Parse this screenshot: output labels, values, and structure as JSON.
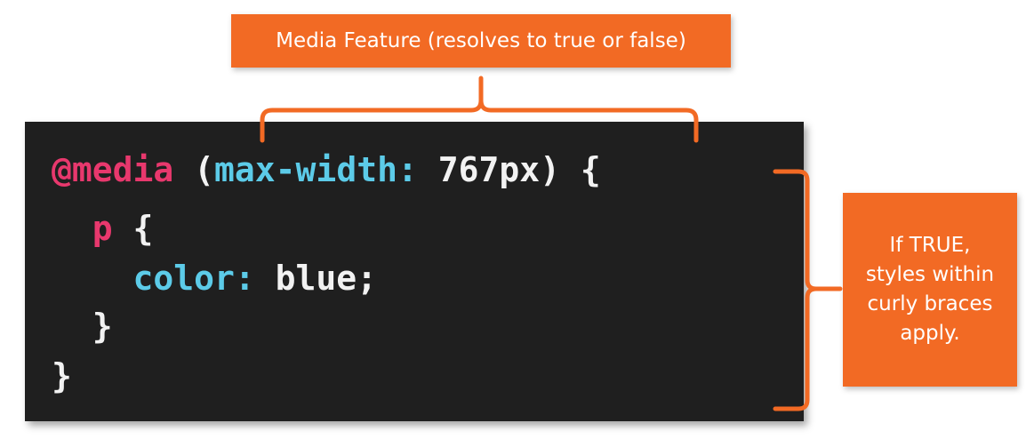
{
  "callouts": {
    "media_feature": "Media Feature (resolves to true or false)",
    "if_true_lines": [
      "If TRUE,",
      "styles within",
      "curly braces",
      "apply."
    ]
  },
  "code": {
    "line1": {
      "at_rule": "@media",
      "open_paren": " (",
      "feature": "max-width:",
      "value": " 767px",
      "close": ") {"
    },
    "line2": {
      "selector": "  p",
      "brace": " {"
    },
    "line3": {
      "property": "    color:",
      "value": " blue;"
    },
    "line4": {
      "brace": "  }"
    },
    "line5": {
      "brace": "}"
    }
  },
  "colors": {
    "accent": "#f26a24",
    "code_background": "#1f1f1f",
    "keyword": "#e8386d",
    "property": "#5ccbe8",
    "text": "#f2f2f2"
  }
}
